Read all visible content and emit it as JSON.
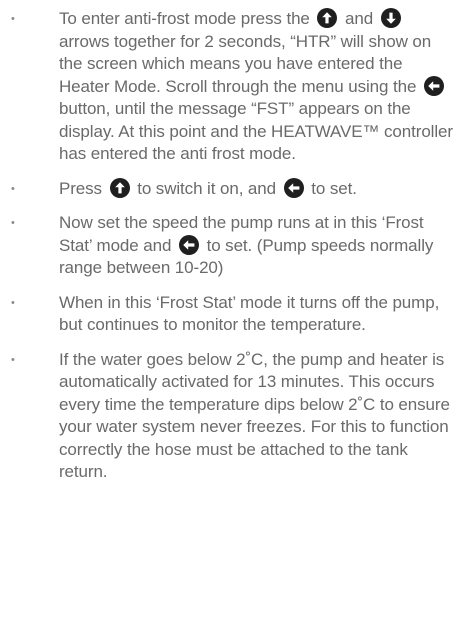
{
  "bullets": [
    {
      "parts": [
        "To enter anti-frost mode press the ",
        " and ",
        " arrows together for 2 seconds, “HTR” will show on the screen which means you have entered the Heater Mode. Scroll through the menu using the ",
        " button, until the message “FST” appears on the display. At this point and the HEATWAVE™ controller has entered the anti frost mode."
      ],
      "icons": [
        "up-arrow-icon",
        "down-arrow-icon",
        "left-arrow-icon"
      ]
    },
    {
      "parts": [
        "Press ",
        " to switch it on, and ",
        " to set."
      ],
      "icons": [
        "up-arrow-icon",
        "left-arrow-icon"
      ]
    },
    {
      "parts": [
        "Now set the speed the pump runs at in this ‘Frost Stat’ mode and ",
        " to set. (Pump speeds normally range between 10-20)"
      ],
      "icons": [
        "left-arrow-icon"
      ]
    },
    {
      "parts": [
        "When in this ‘Frost Stat’ mode it turns off the pump, but continues to monitor the temperature."
      ],
      "icons": []
    },
    {
      "parts": [
        "If the water goes below 2˚C, the pump and heater is automatically activated for 13 minutes. This occurs every time the temperature dips below 2˚C to ensure your water system never freezes. For this to function correctly the hose must be attached to the tank return."
      ],
      "icons": []
    }
  ],
  "bullet_symbol": "•",
  "colors": {
    "text": "#6a6a6a",
    "icon_background": "#1f1f1f",
    "icon_arrow": "#ffffff"
  }
}
